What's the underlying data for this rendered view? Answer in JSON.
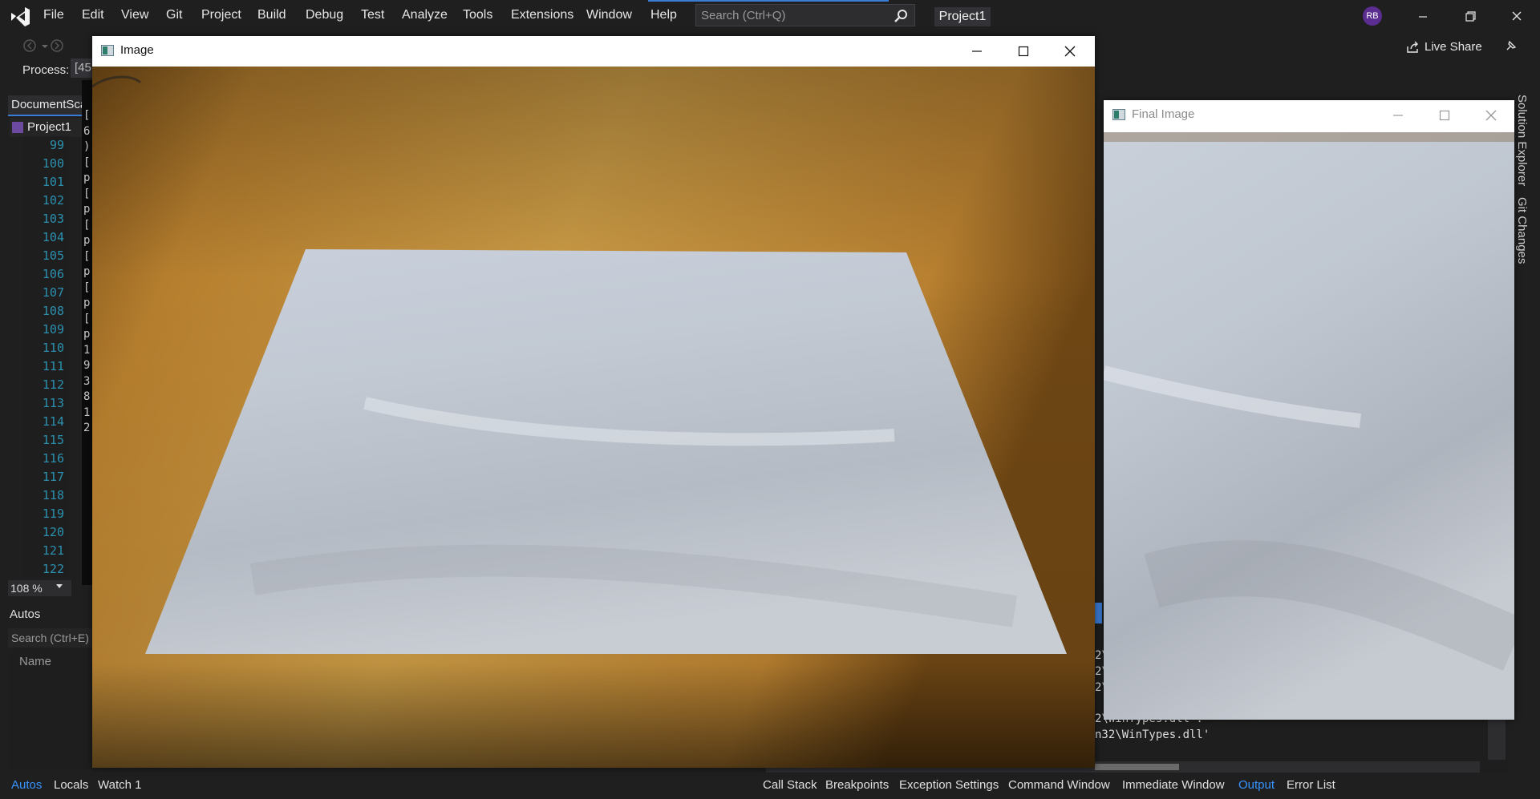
{
  "menu": [
    "File",
    "Edit",
    "View",
    "Git",
    "Project",
    "Build",
    "Debug",
    "Test",
    "Analyze",
    "Tools",
    "Extensions",
    "Window",
    "Help"
  ],
  "search": {
    "placeholder": "Search (Ctrl+Q)"
  },
  "solution_name": "Project1",
  "profile_initials": "RB",
  "toolbar": {
    "process_label": "Process:",
    "process_value": "[45",
    "live_share": "Live Share"
  },
  "editor": {
    "doc_tab": "DocumentSca",
    "project_node": "Project1",
    "line_numbers": [
      "99",
      "100",
      "101",
      "102",
      "103",
      "104",
      "105",
      "106",
      "107",
      "108",
      "109",
      "110",
      "111",
      "112",
      "113",
      "114",
      "115",
      "116",
      "117",
      "118",
      "119",
      "120",
      "121",
      "122"
    ],
    "console_chars": [
      "[",
      "6",
      ")",
      "[",
      "p",
      "[",
      "p",
      "[",
      "p",
      "[",
      "p",
      "[",
      "p",
      "[",
      "p",
      "1",
      "9",
      "3",
      "8",
      "1",
      "2"
    ],
    "zoom": "108 %"
  },
  "autos": {
    "title": "Autos",
    "search_placeholder": "Search (Ctrl+E)",
    "column_name": "Name"
  },
  "bottom_tabs_left": [
    "Autos",
    "Locals",
    "Watch 1"
  ],
  "bottom_tabs_right": [
    "Call Stack",
    "Breakpoints",
    "Exception Settings",
    "Command Window",
    "Immediate Window",
    "Output",
    "Error List"
  ],
  "output_lines": [
    "2\\",
    "2\\",
    "2\\",
    "2\\WinTypes.dll'.",
    "n32\\WinTypes.dll'"
  ],
  "side_tabs": [
    "Solution Explorer",
    "Git Changes"
  ],
  "windows": {
    "image": {
      "title": "Image"
    },
    "final": {
      "title": "Final Image"
    }
  },
  "colors": {
    "accent": "#3b7cd6",
    "active_tab": "#3794ff",
    "profile": "#5b2d91",
    "line_numbers": "#2b91af"
  }
}
